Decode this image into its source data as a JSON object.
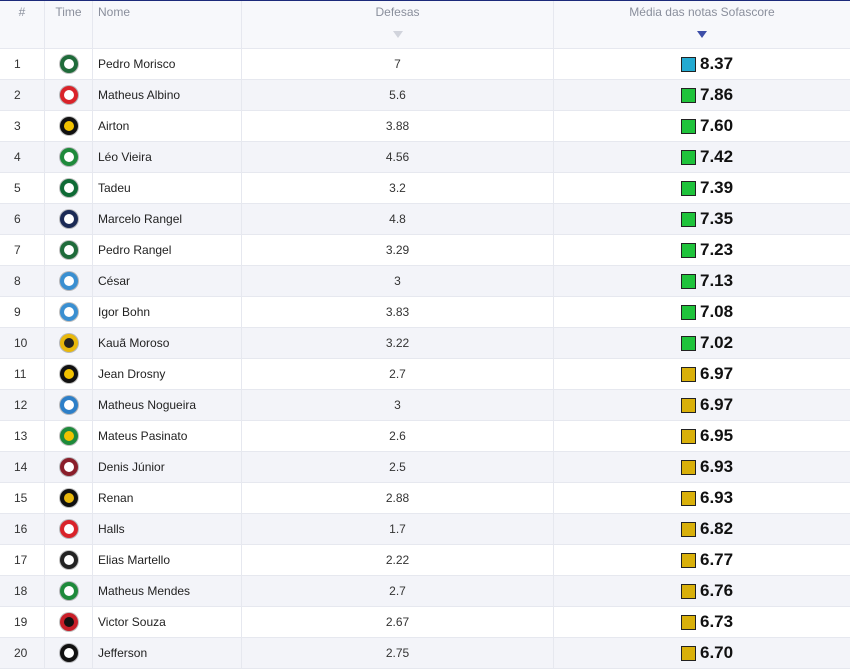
{
  "columns": {
    "index": "#",
    "team": "Time",
    "name": "Nome",
    "saves": "Defesas",
    "rating": "Média das notas Sofascore"
  },
  "colors": {
    "rating_blue": "#23aad1",
    "rating_green": "#1fc33b",
    "rating_yellow": "#d9b00a",
    "active_sort": "#3d4fa8"
  },
  "players": [
    {
      "rank": "1",
      "name": "Pedro Morisco",
      "saves": "7",
      "rating": "8.37",
      "tier": "blue",
      "team_icon": "coritiba-crest-icon",
      "team_color": "#1f6b3a",
      "team_accent": "#ffffff"
    },
    {
      "rank": "2",
      "name": "Matheus Albino",
      "saves": "5.6",
      "rating": "7.86",
      "tier": "green",
      "team_icon": "crb-crest-icon",
      "team_color": "#d9232a",
      "team_accent": "#ffffff"
    },
    {
      "rank": "3",
      "name": "Airton",
      "saves": "3.88",
      "rating": "7.60",
      "tier": "green",
      "team_icon": "novorizontino-crest-icon",
      "team_color": "#111111",
      "team_accent": "#f2c200"
    },
    {
      "rank": "4",
      "name": "Léo Vieira",
      "saves": "4.56",
      "rating": "7.42",
      "tier": "green",
      "team_icon": "chapecoense-crest-icon",
      "team_color": "#1e8a3b",
      "team_accent": "#ffffff"
    },
    {
      "rank": "5",
      "name": "Tadeu",
      "saves": "3.2",
      "rating": "7.39",
      "tier": "green",
      "team_icon": "goias-crest-icon",
      "team_color": "#0f6b35",
      "team_accent": "#ffffff"
    },
    {
      "rank": "6",
      "name": "Marcelo Rangel",
      "saves": "4.8",
      "rating": "7.35",
      "tier": "green",
      "team_icon": "remo-crest-icon",
      "team_color": "#1b2a55",
      "team_accent": "#ffffff"
    },
    {
      "rank": "7",
      "name": "Pedro Rangel",
      "saves": "3.29",
      "rating": "7.23",
      "tier": "green",
      "team_icon": "coritiba-crest-icon",
      "team_color": "#1f6b3a",
      "team_accent": "#ffffff"
    },
    {
      "rank": "8",
      "name": "César",
      "saves": "3",
      "rating": "7.13",
      "tier": "green",
      "team_icon": "avai-crest-icon",
      "team_color": "#3a8fd1",
      "team_accent": "#ffffff"
    },
    {
      "rank": "9",
      "name": "Igor Bohn",
      "saves": "3.83",
      "rating": "7.08",
      "tier": "green",
      "team_icon": "avai-crest-icon",
      "team_color": "#3a8fd1",
      "team_accent": "#ffffff"
    },
    {
      "rank": "10",
      "name": "Kauã Moroso",
      "saves": "3.22",
      "rating": "7.02",
      "tier": "green",
      "team_icon": "amazonas-crest-icon",
      "team_color": "#e8b80c",
      "team_accent": "#222222"
    },
    {
      "rank": "11",
      "name": "Jean Drosny",
      "saves": "2.7",
      "rating": "6.97",
      "tier": "yellow",
      "team_icon": "volta-redonda-crest-icon",
      "team_color": "#111111",
      "team_accent": "#f2c200"
    },
    {
      "rank": "12",
      "name": "Matheus Nogueira",
      "saves": "3",
      "rating": "6.97",
      "tier": "yellow",
      "team_icon": "parana-crest-icon",
      "team_color": "#2d7fc8",
      "team_accent": "#ffffff"
    },
    {
      "rank": "13",
      "name": "Mateus Pasinato",
      "saves": "2.6",
      "rating": "6.95",
      "tier": "yellow",
      "team_icon": "cuiaba-crest-icon",
      "team_color": "#1e8a3b",
      "team_accent": "#f2c200"
    },
    {
      "rank": "14",
      "name": "Denis Júnior",
      "saves": "2.5",
      "rating": "6.93",
      "tier": "yellow",
      "team_icon": "ferroviaria-crest-icon",
      "team_color": "#8a1e2a",
      "team_accent": "#ffffff"
    },
    {
      "rank": "15",
      "name": "Renan",
      "saves": "2.88",
      "rating": "6.93",
      "tier": "yellow",
      "team_icon": "athletic-crest-icon",
      "team_color": "#111111",
      "team_accent": "#e8b80c"
    },
    {
      "rank": "16",
      "name": "Halls",
      "saves": "1.7",
      "rating": "6.82",
      "tier": "yellow",
      "team_icon": "vila-nova-crest-icon",
      "team_color": "#d9232a",
      "team_accent": "#ffffff"
    },
    {
      "rank": "17",
      "name": "Elias Martello",
      "saves": "2.22",
      "rating": "6.77",
      "tier": "yellow",
      "team_icon": "operario-crest-icon",
      "team_color": "#222222",
      "team_accent": "#ffffff"
    },
    {
      "rank": "18",
      "name": "Matheus Mendes",
      "saves": "2.7",
      "rating": "6.76",
      "tier": "yellow",
      "team_icon": "america-mg-crest-icon",
      "team_color": "#1e8a3b",
      "team_accent": "#ffffff"
    },
    {
      "rank": "19",
      "name": "Victor Souza",
      "saves": "2.67",
      "rating": "6.73",
      "tier": "yellow",
      "team_icon": "botafogo-sp-crest-icon",
      "team_color": "#c81e28",
      "team_accent": "#111111"
    },
    {
      "rank": "20",
      "name": "Jefferson",
      "saves": "2.75",
      "rating": "6.70",
      "tier": "yellow",
      "team_icon": "atletico-go-crest-icon",
      "team_color": "#111111",
      "team_accent": "#ffffff"
    }
  ]
}
